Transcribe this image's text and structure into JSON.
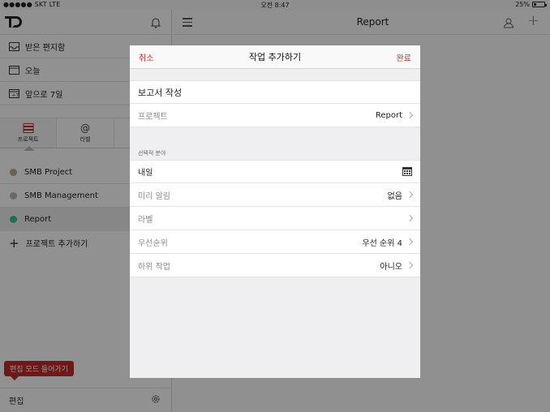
{
  "status_bar": {
    "carrier": "●●●●● SKT  LTE",
    "time": "오전 8:47",
    "battery": "25%"
  },
  "sidebar": {
    "logo_icon": "todoist-logo",
    "nav": [
      {
        "label": "받은 편지함",
        "icon": "inbox-icon"
      },
      {
        "label": "오늘",
        "icon": "calendar-icon"
      },
      {
        "label": "앞으로 7일",
        "icon": "calendar-7-icon"
      }
    ],
    "tabs": [
      {
        "label": "프로젝트",
        "icon": "projects-icon",
        "active": true
      },
      {
        "label": "라벨",
        "icon": "at-icon",
        "glyph": "@",
        "active": false
      }
    ],
    "projects": [
      {
        "name": "SMB Project",
        "color": "#b5a48f"
      },
      {
        "name": "SMB Management",
        "color": "#b3b3b3"
      },
      {
        "name": "Report",
        "color": "#3cb9a3"
      }
    ],
    "add_project": "프로젝트 추가하기",
    "edit_tooltip": "편집 모드 들어가기",
    "footer_edit": "편집"
  },
  "main": {
    "title": "Report"
  },
  "modal": {
    "cancel": "취소",
    "title": "작업 추가하기",
    "done": "완료",
    "task_name": "보고서 작성",
    "project_label": "프로젝트",
    "project_value": "Report",
    "optional_section": "선택적 분야",
    "rows": [
      {
        "label": "내일",
        "value": "",
        "icon": "calendar-icon"
      },
      {
        "label": "미리 알림",
        "value": "없음"
      },
      {
        "label": "라벨",
        "value": ""
      },
      {
        "label": "우선순위",
        "value": "우선 순위 4"
      },
      {
        "label": "하위 작업",
        "value": "아니오"
      }
    ]
  },
  "colors": {
    "accent": "#d0312d",
    "overlay": "rgba(0,0,0,0.42)"
  }
}
